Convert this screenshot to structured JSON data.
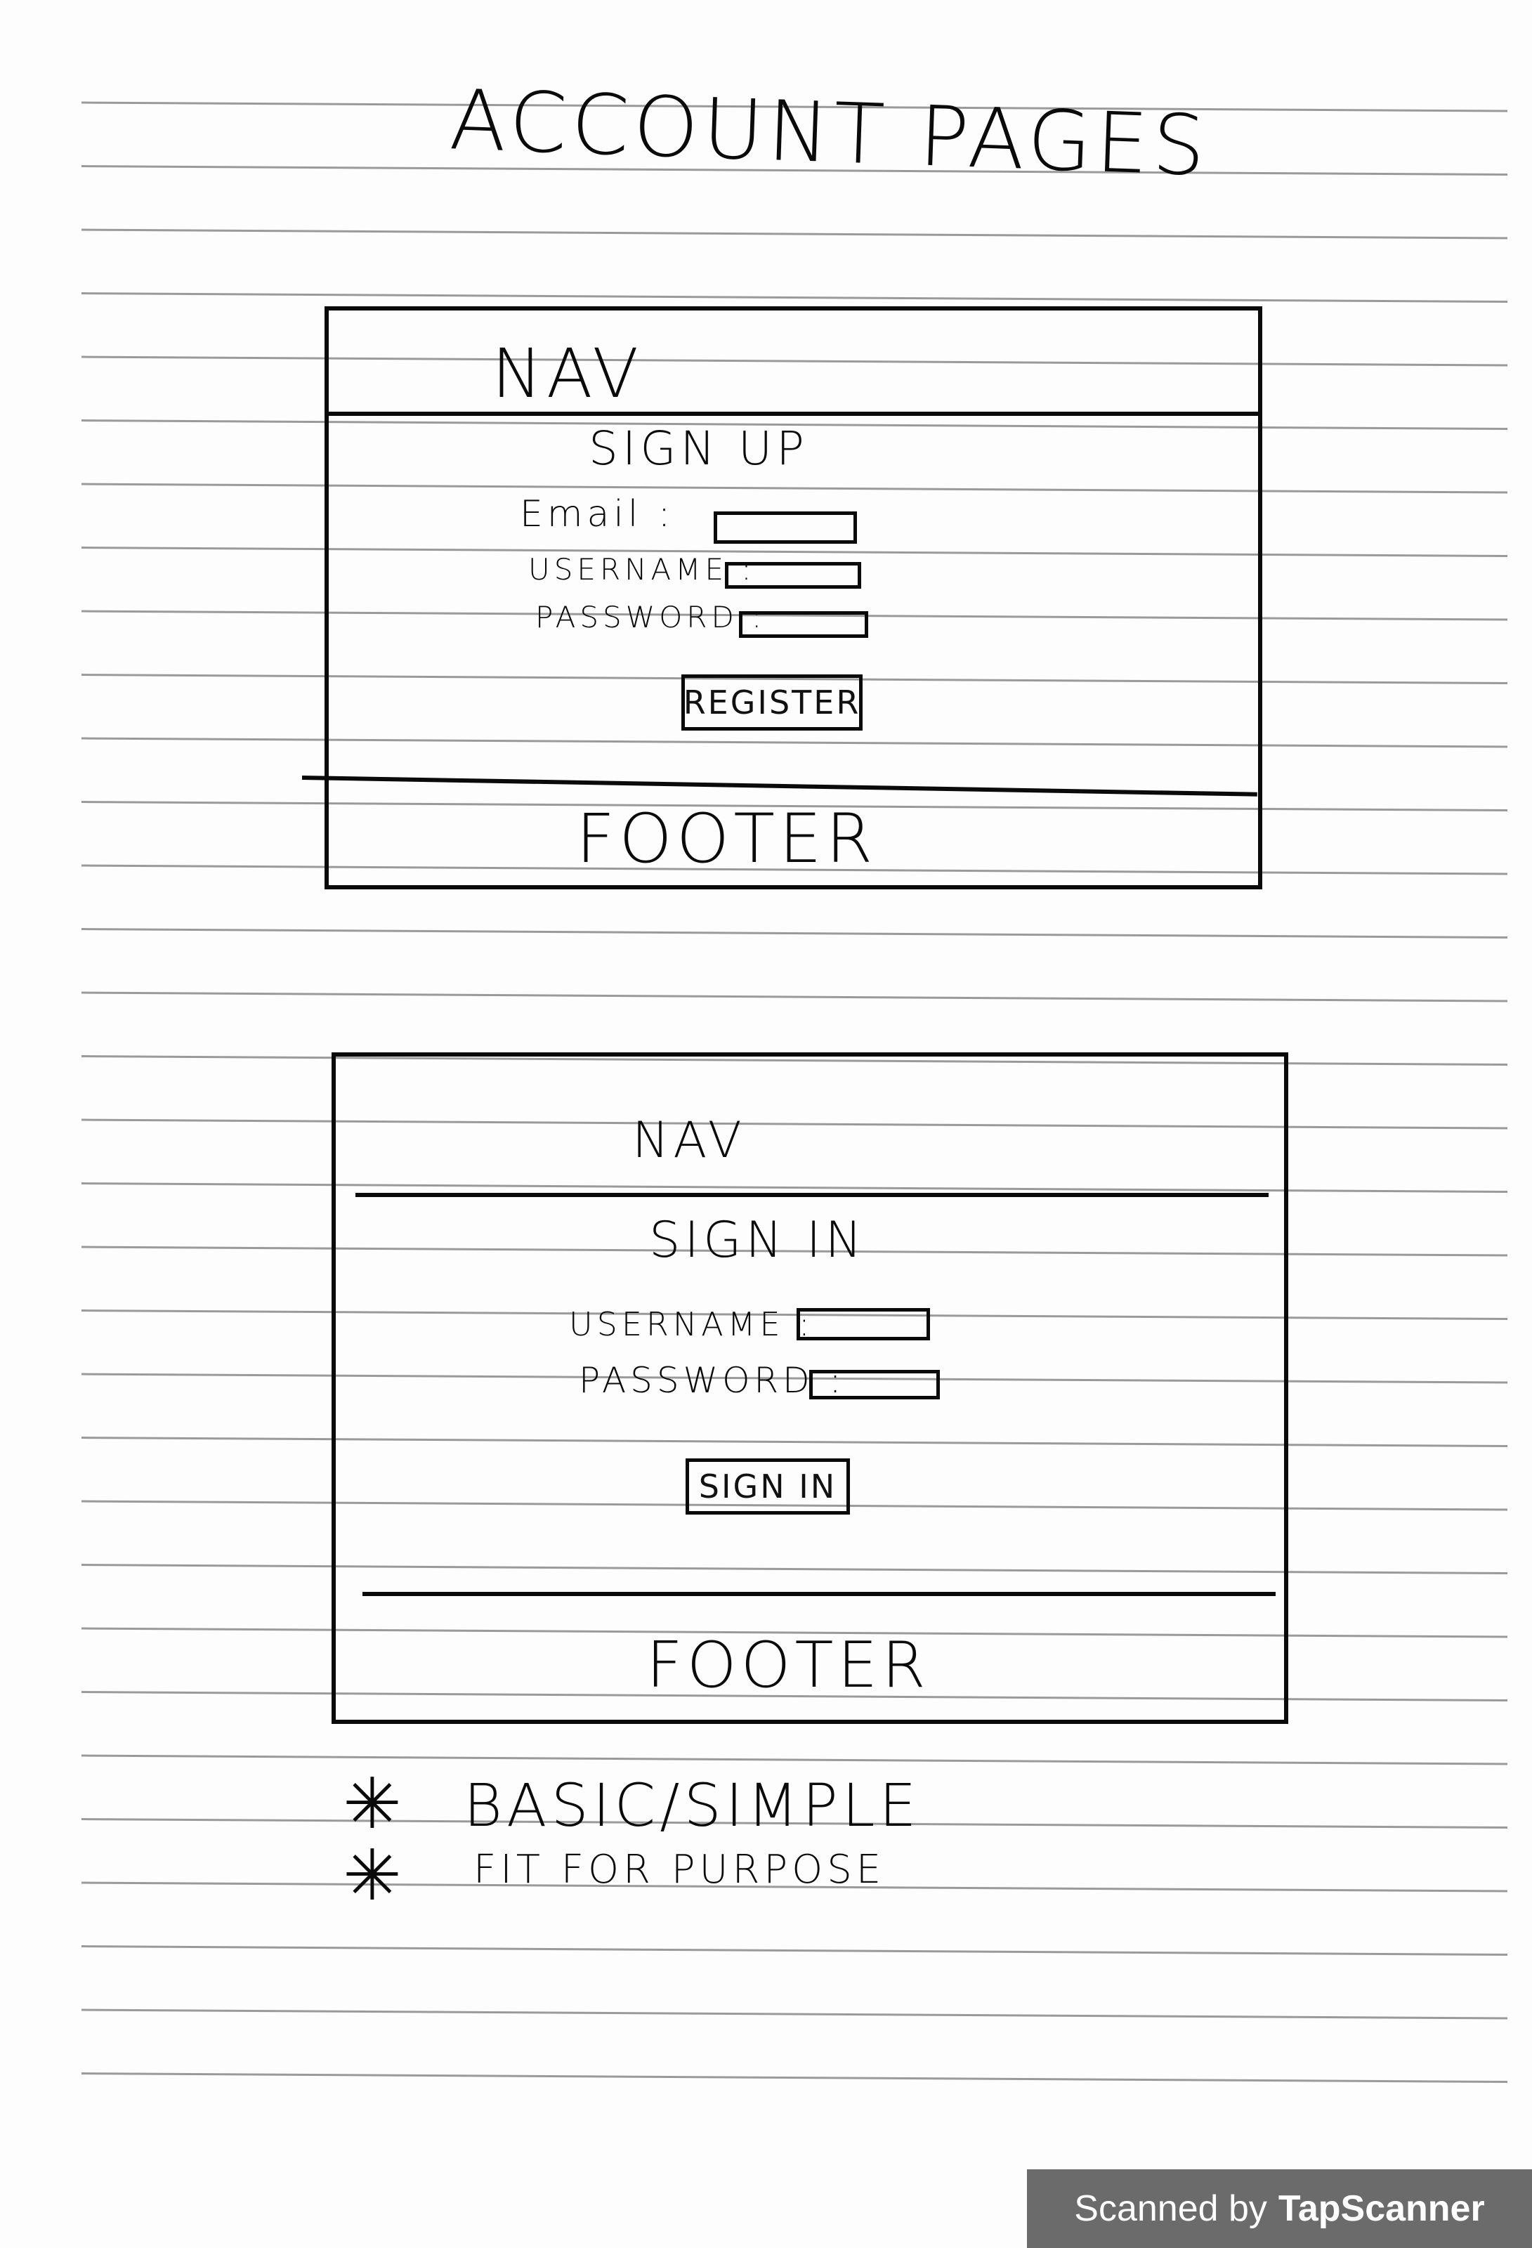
{
  "page_title": "ACCOUNT PAGES",
  "signup_wireframe": {
    "nav_label": "NAV",
    "heading": "SIGN UP",
    "fields": [
      {
        "label": "Email :"
      },
      {
        "label": "USERNAME :"
      },
      {
        "label": "PASSWORD :"
      }
    ],
    "button_label": "REGISTER",
    "footer_label": "FOOTER"
  },
  "signin_wireframe": {
    "nav_label": "NAV",
    "heading": "SIGN IN",
    "fields": [
      {
        "label": "USERNAME :"
      },
      {
        "label": "PASSWORD :"
      }
    ],
    "button_label": "SIGN IN",
    "footer_label": "FOOTER"
  },
  "notes": [
    {
      "bullet": "✳",
      "text": "BASIC/SIMPLE"
    },
    {
      "bullet": "✳",
      "text": "FIT FOR PURPOSE"
    }
  ],
  "watermark": {
    "prefix": "Scanned by",
    "brand": "TapScanner"
  },
  "colors": {
    "ink": "#0a0a0a",
    "ruled_line": "#9a9a9a",
    "paper": "#fdfdfd",
    "badge_bg": "#6b6b6b"
  }
}
